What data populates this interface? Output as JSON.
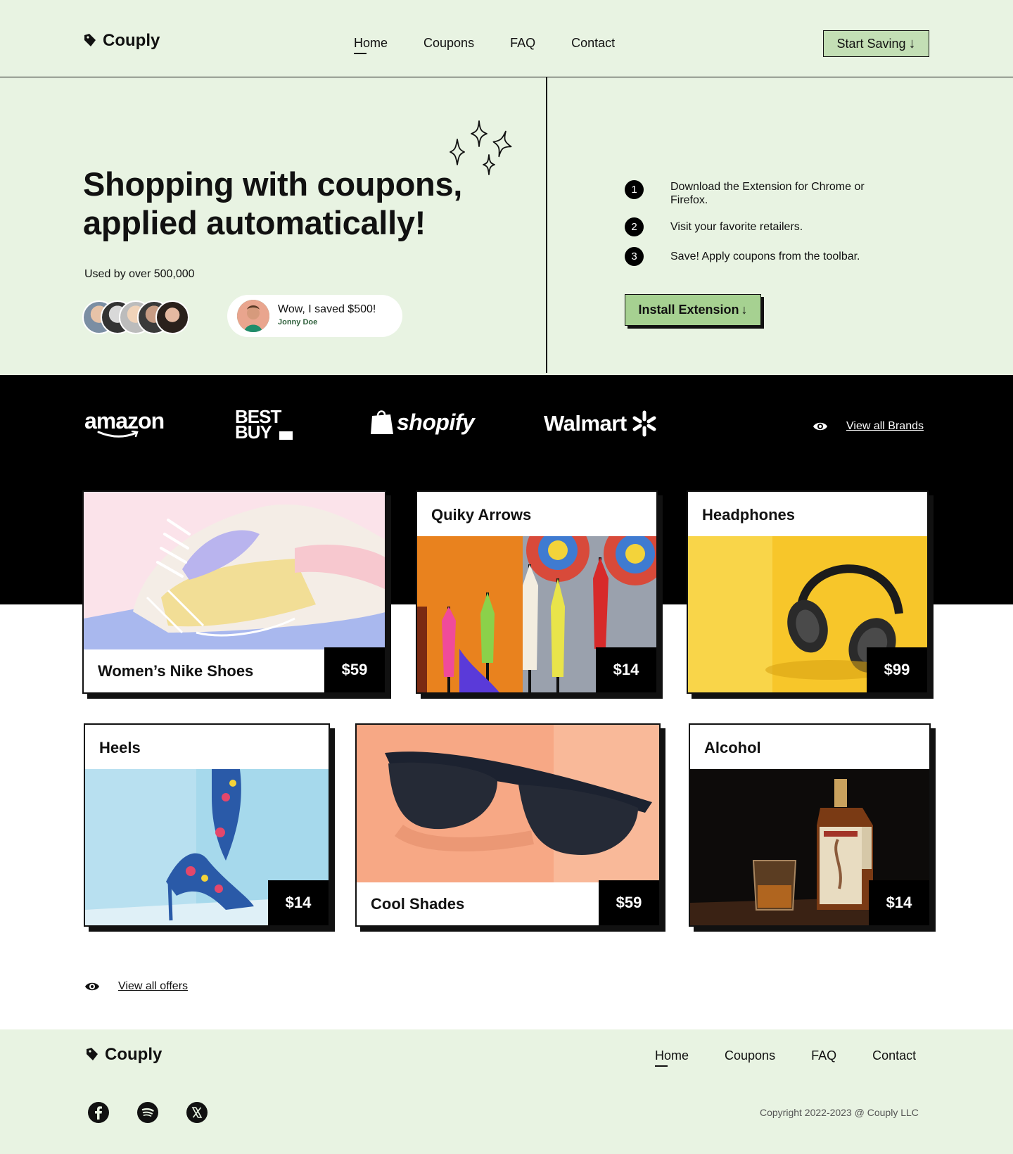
{
  "header": {
    "logo_text": "Couply",
    "nav": [
      "Home",
      "Coupons",
      "FAQ",
      "Contact"
    ],
    "cta_label": "Start Saving",
    "cta_arrow": "↓"
  },
  "hero": {
    "title_line1": "Shopping with coupons,",
    "title_line2": "applied automatically!",
    "used_by": "Used by over 500,000",
    "testimonial_text": "Wow, I saved $500!",
    "testimonial_name": "Jonny Doe",
    "steps": [
      {
        "num": "1",
        "text": "Download the Extension for Chrome or Firefox."
      },
      {
        "num": "2",
        "text": "Visit your favorite retailers."
      },
      {
        "num": "3",
        "text": "Save! Apply coupons from the toolbar."
      }
    ],
    "install_label": "Install Extension",
    "install_arrow": "↓"
  },
  "brands": {
    "items": [
      "amazon",
      "BEST BUY",
      "shopify",
      "Walmart"
    ],
    "view_all": "View all Brands"
  },
  "products": [
    {
      "title": "Women’s Nike Shoes",
      "price": "$59"
    },
    {
      "title": "Quiky Arrows",
      "price": "$14"
    },
    {
      "title": "Headphones",
      "price": "$99"
    },
    {
      "title": "Heels",
      "price": "$14"
    },
    {
      "title": "Cool Shades",
      "price": "$59"
    },
    {
      "title": "Alcohol",
      "price": "$14"
    }
  ],
  "view_offers": "View all offers",
  "footer": {
    "logo_text": "Couply",
    "nav": [
      "Home",
      "Coupons",
      "FAQ",
      "Contact"
    ],
    "socials": [
      "facebook-icon",
      "spotify-icon",
      "x-icon"
    ],
    "copyright": "Copyright 2022-2023 @ Couply LLC"
  },
  "colors": {
    "mint_bg": "#e8f3e2",
    "button_green": "#a6d191",
    "start_btn_green": "#c3dfb5",
    "dark": "#111111"
  }
}
